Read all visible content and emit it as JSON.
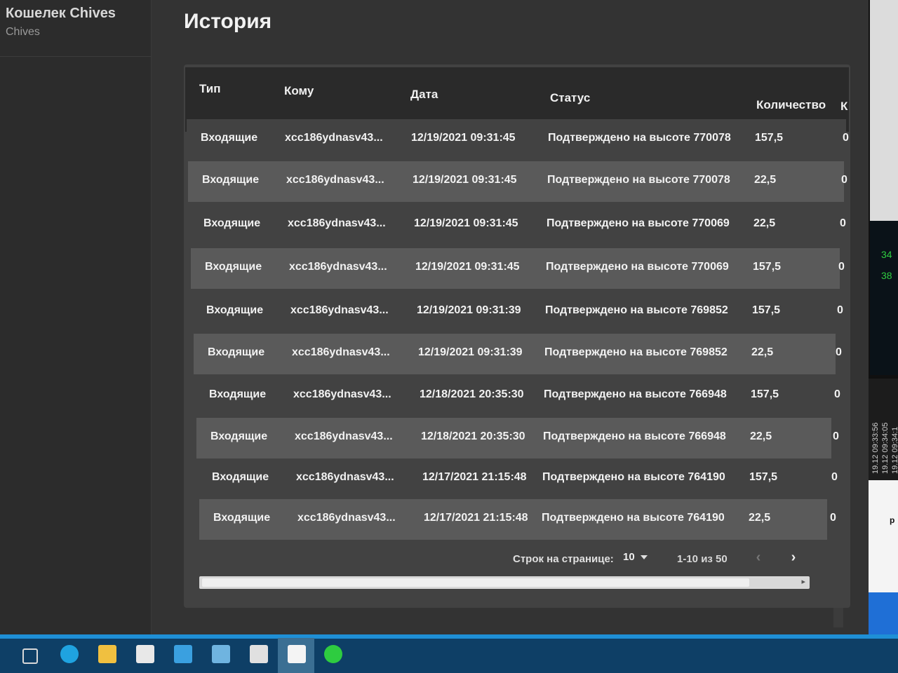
{
  "app": {
    "name": "Кошелек Chives",
    "subtitle": "Chives"
  },
  "page": {
    "title": "История"
  },
  "table": {
    "columns": [
      "Тип",
      "Кому",
      "Дата",
      "Статус",
      "Количество",
      "К"
    ],
    "rows": [
      {
        "type": "Входящие",
        "to": "xcc186ydnasv43...",
        "date": "12/19/2021 09:31:45",
        "status": "Подтверждено на высоте 770078",
        "amount": "157,5",
        "extra": "0"
      },
      {
        "type": "Входящие",
        "to": "xcc186ydnasv43...",
        "date": "12/19/2021 09:31:45",
        "status": "Подтверждено на высоте 770078",
        "amount": "22,5",
        "extra": "0"
      },
      {
        "type": "Входящие",
        "to": "xcc186ydnasv43...",
        "date": "12/19/2021 09:31:45",
        "status": "Подтверждено на высоте 770069",
        "amount": "22,5",
        "extra": "0"
      },
      {
        "type": "Входящие",
        "to": "xcc186ydnasv43...",
        "date": "12/19/2021 09:31:45",
        "status": "Подтверждено на высоте 770069",
        "amount": "157,5",
        "extra": "0"
      },
      {
        "type": "Входящие",
        "to": "xcc186ydnasv43...",
        "date": "12/19/2021 09:31:39",
        "status": "Подтверждено на высоте 769852",
        "amount": "157,5",
        "extra": "0"
      },
      {
        "type": "Входящие",
        "to": "xcc186ydnasv43...",
        "date": "12/19/2021 09:31:39",
        "status": "Подтверждено на высоте 769852",
        "amount": "22,5",
        "extra": "0"
      },
      {
        "type": "Входящие",
        "to": "xcc186ydnasv43...",
        "date": "12/18/2021 20:35:30",
        "status": "Подтверждено на высоте 766948",
        "amount": "157,5",
        "extra": "0"
      },
      {
        "type": "Входящие",
        "to": "xcc186ydnasv43...",
        "date": "12/18/2021 20:35:30",
        "status": "Подтверждено на высоте 766948",
        "amount": "22,5",
        "extra": "0"
      },
      {
        "type": "Входящие",
        "to": "xcc186ydnasv43...",
        "date": "12/17/2021 21:15:48",
        "status": "Подтверждено на высоте 764190",
        "amount": "157,5",
        "extra": "0"
      },
      {
        "type": "Входящие",
        "to": "xcc186ydnasv43...",
        "date": "12/17/2021 21:15:48",
        "status": "Подтверждено на высоте 764190",
        "amount": "22,5",
        "extra": "0"
      }
    ]
  },
  "pagination": {
    "rows_per_page_label": "Строк на странице:",
    "rows_per_page": "10",
    "range": "1-10 из 50",
    "prev_icon": "chevron-left-icon",
    "next_icon": "chevron-right-icon"
  },
  "background_window": {
    "values": [
      "34",
      "38"
    ],
    "times": [
      "19.12 09:33:56",
      "19.12 09:34:05",
      "19.12 09:34:1"
    ],
    "blue_text": "p"
  },
  "taskbar": {
    "icons": [
      "task-view-icon",
      "edge-icon",
      "file-explorer-icon",
      "store-icon",
      "mail-icon",
      "monitor-icon",
      "photos-icon",
      "chives-wallet-icon",
      "chia-leaf-icon"
    ]
  },
  "colors": {
    "accent_green": "#2ecc40",
    "taskbar": "#0e3f66",
    "taskbar_edge": "#1e8fd6"
  }
}
